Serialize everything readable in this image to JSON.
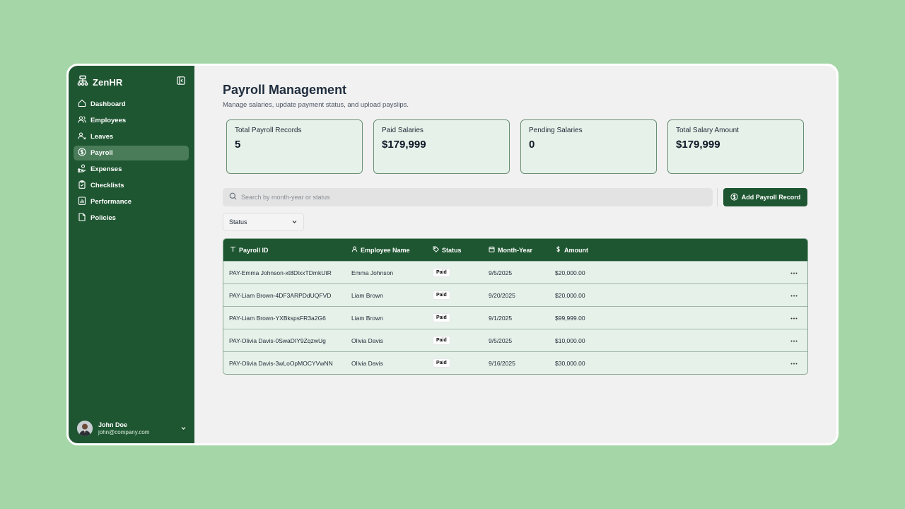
{
  "app": {
    "name": "ZenHR"
  },
  "sidebar": {
    "items": [
      {
        "label": "Dashboard",
        "icon": "home-icon"
      },
      {
        "label": "Employees",
        "icon": "users-icon"
      },
      {
        "label": "Leaves",
        "icon": "user-x-icon"
      },
      {
        "label": "Payroll",
        "icon": "dollar-circle-icon",
        "active": true
      },
      {
        "label": "Expenses",
        "icon": "hand-coins-icon"
      },
      {
        "label": "Checklists",
        "icon": "clipboard-check-icon"
      },
      {
        "label": "Performance",
        "icon": "bar-chart-file-icon"
      },
      {
        "label": "Policies",
        "icon": "file-icon"
      }
    ],
    "user": {
      "name": "John Doe",
      "email": "john@company.com"
    }
  },
  "header": {
    "title": "Payroll Management",
    "subtitle": "Manage salaries, update payment status, and upload payslips."
  },
  "stats": [
    {
      "label": "Total Payroll Records",
      "value": "5"
    },
    {
      "label": "Paid Salaries",
      "value": "$179,999"
    },
    {
      "label": "Pending Salaries",
      "value": "0"
    },
    {
      "label": "Total Salary Amount",
      "value": "$179,999"
    }
  ],
  "search": {
    "placeholder": "Search by month-year or status",
    "value": ""
  },
  "add_button": {
    "label": "Add Payroll Record"
  },
  "filter": {
    "label": "Status"
  },
  "table": {
    "columns": [
      "Payroll ID",
      "Employee Name",
      "Status",
      "Month-Year",
      "Amount"
    ],
    "rows": [
      {
        "id": "PAY-Emma Johnson-xt8DlxxTDmkUtR",
        "name": "Emma Johnson",
        "status": "Paid",
        "month": "9/5/2025",
        "amount": "$20,000.00"
      },
      {
        "id": "PAY-Liam Brown-4DF3ARPDdUQFVD",
        "name": "Liam Brown",
        "status": "Paid",
        "month": "9/20/2025",
        "amount": "$20,000.00"
      },
      {
        "id": "PAY-Liam Brown-YXBkspsFR3a2G6",
        "name": "Liam Brown",
        "status": "Paid",
        "month": "9/1/2025",
        "amount": "$99,999.00"
      },
      {
        "id": "PAY-Olivia Davis-0SwaDIY9ZqzwUg",
        "name": "Olivia Davis",
        "status": "Paid",
        "month": "9/5/2025",
        "amount": "$10,000.00"
      },
      {
        "id": "PAY-Olivia Davis-3wLoOpMOCYVwNN",
        "name": "Olivia Davis",
        "status": "Paid",
        "month": "9/16/2025",
        "amount": "$30,000.00"
      }
    ]
  },
  "colors": {
    "brand": "#1e5631",
    "background": "#a5d6a7",
    "card": "#e6f1e9"
  }
}
